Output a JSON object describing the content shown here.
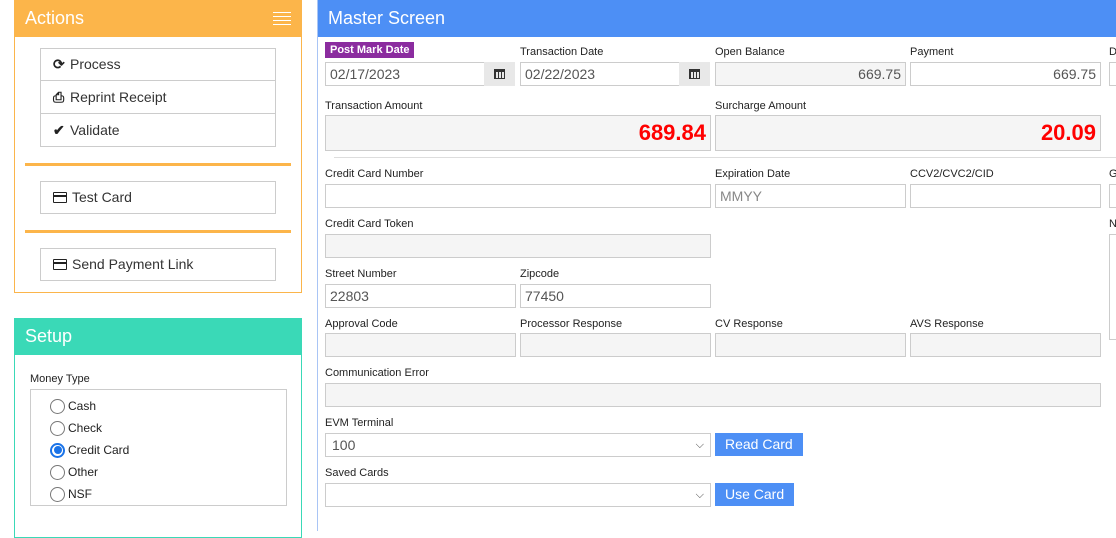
{
  "actions": {
    "title": "Actions",
    "menu_icon": "hamburger-icon",
    "buttons": [
      {
        "label": "Process",
        "icon": "refresh-icon",
        "glyph": "⟳"
      },
      {
        "label": "Reprint Receipt",
        "icon": "print-icon",
        "glyph": "⎙"
      },
      {
        "label": "Validate",
        "icon": "check-icon",
        "glyph": "✔"
      },
      {
        "label": "Test Card",
        "icon": "credit-card-icon"
      },
      {
        "label": "Send Payment Link",
        "icon": "credit-card-icon"
      }
    ],
    "accent": "#fcb54a"
  },
  "setup": {
    "title": "Setup",
    "accent": "#3ad9b7",
    "money_type": {
      "label": "Money Type",
      "options": [
        "Cash",
        "Check",
        "Credit Card",
        "Other",
        "NSF"
      ],
      "selected": "Credit Card"
    }
  },
  "master": {
    "title": "Master Screen",
    "accent": "#4d8ff5",
    "post_mark_date": {
      "label": "Post Mark Date",
      "value": "02/17/2023"
    },
    "transaction_date": {
      "label": "Transaction Date",
      "value": "02/22/2023"
    },
    "open_balance": {
      "label": "Open Balance",
      "value": "669.75"
    },
    "payment": {
      "label": "Payment",
      "value": "669.75"
    },
    "cut_off_label_d": "D",
    "transaction_amount": {
      "label": "Transaction Amount",
      "value": "689.84"
    },
    "surcharge_amount": {
      "label": "Surcharge Amount",
      "value": "20.09"
    },
    "credit_card_number": {
      "label": "Credit Card Number",
      "value": ""
    },
    "expiration_date": {
      "label": "Expiration Date",
      "placeholder": "MMYY"
    },
    "cvv": {
      "label": "CCV2/CVC2/CID",
      "value": ""
    },
    "cut_off_label_g": "G",
    "cut_off_label_n": "N",
    "credit_card_token": {
      "label": "Credit Card Token",
      "value": ""
    },
    "street_number": {
      "label": "Street Number",
      "value": "22803"
    },
    "zipcode": {
      "label": "Zipcode",
      "value": "77450"
    },
    "approval_code": {
      "label": "Approval Code",
      "value": ""
    },
    "processor_response": {
      "label": "Processor Response",
      "value": ""
    },
    "cv_response": {
      "label": "CV Response",
      "value": ""
    },
    "avs_response": {
      "label": "AVS Response",
      "value": ""
    },
    "communication_error": {
      "label": "Communication Error",
      "value": ""
    },
    "evm_terminal": {
      "label": "EVM Terminal",
      "value": "100"
    },
    "read_card_label": "Read Card",
    "saved_cards": {
      "label": "Saved Cards",
      "value": ""
    },
    "use_card_label": "Use Card"
  }
}
